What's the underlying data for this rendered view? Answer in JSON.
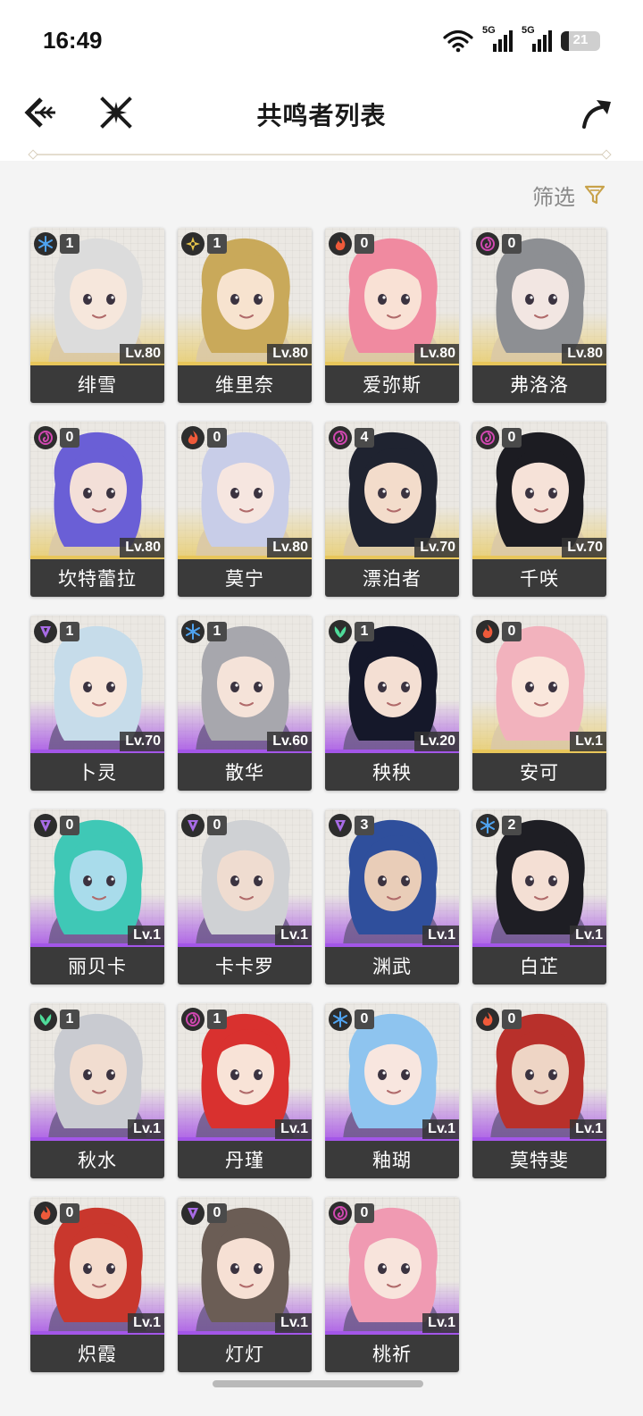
{
  "status_bar": {
    "time": "16:49",
    "network_1": "5G",
    "network_2": "5G",
    "battery_level": "21"
  },
  "header": {
    "title": "共鸣者列表",
    "back_icon": "back-arrow-icon",
    "home_icon": "game-logo-icon",
    "share_icon": "share-arrow-icon"
  },
  "filter": {
    "label": "筛选",
    "icon": "filter-funnel-icon",
    "color": "#c8a24a"
  },
  "element_colors": {
    "glacio": "#4fa3f0",
    "spectro": "#e6c44a",
    "fusion": "#ef5a3a",
    "havoc": "#d048b0",
    "electro": "#a86be6",
    "aero": "#4fdc9a"
  },
  "characters": [
    {
      "name": "绯雪",
      "chain": "1",
      "level": "Lv.80",
      "element": "glacio",
      "rarity": 5,
      "hair": "#dcdcdc",
      "skin": "#f6e7dc"
    },
    {
      "name": "维里奈",
      "chain": "1",
      "level": "Lv.80",
      "element": "spectro",
      "rarity": 5,
      "hair": "#c9a95a",
      "skin": "#f7e3cf"
    },
    {
      "name": "爱弥斯",
      "chain": "0",
      "level": "Lv.80",
      "element": "fusion",
      "rarity": 5,
      "hair": "#f08aa0",
      "skin": "#f9e1d5"
    },
    {
      "name": "弗洛洛",
      "chain": "0",
      "level": "Lv.80",
      "element": "havoc",
      "rarity": 5,
      "hair": "#8d8f93",
      "skin": "#f2e6e2"
    },
    {
      "name": "坎特蕾拉",
      "chain": "0",
      "level": "Lv.80",
      "element": "havoc",
      "rarity": 5,
      "hair": "#6a5fd6",
      "skin": "#f3dfd8"
    },
    {
      "name": "莫宁",
      "chain": "0",
      "level": "Lv.80",
      "element": "fusion",
      "rarity": 5,
      "hair": "#c8cde8",
      "skin": "#f6e6e0"
    },
    {
      "name": "漂泊者",
      "chain": "4",
      "level": "Lv.70",
      "element": "havoc",
      "rarity": 5,
      "hair": "#1f2330",
      "skin": "#f3dccb"
    },
    {
      "name": "千咲",
      "chain": "0",
      "level": "Lv.70",
      "element": "havoc",
      "rarity": 5,
      "hair": "#1c1c22",
      "skin": "#f6e2d8"
    },
    {
      "name": "卜灵",
      "chain": "1",
      "level": "Lv.70",
      "element": "electro",
      "rarity": 4,
      "hair": "#c6dcea",
      "skin": "#f8e6da"
    },
    {
      "name": "散华",
      "chain": "1",
      "level": "Lv.60",
      "element": "glacio",
      "rarity": 4,
      "hair": "#a7a7ad",
      "skin": "#f5e3d9"
    },
    {
      "name": "秧秧",
      "chain": "1",
      "level": "Lv.20",
      "element": "aero",
      "rarity": 4,
      "hair": "#15182a",
      "skin": "#f4dfd3"
    },
    {
      "name": "安可",
      "chain": "0",
      "level": "Lv.1",
      "element": "fusion",
      "rarity": 5,
      "hair": "#f2b2bd",
      "skin": "#fae7dc"
    },
    {
      "name": "丽贝卡",
      "chain": "0",
      "level": "Lv.1",
      "element": "electro",
      "rarity": 4,
      "hair": "#3fc8b6",
      "skin": "#a9dceb"
    },
    {
      "name": "卡卡罗",
      "chain": "0",
      "level": "Lv.1",
      "element": "electro",
      "rarity": 4,
      "hair": "#cfd1d4",
      "skin": "#efdcd0"
    },
    {
      "name": "渊武",
      "chain": "3",
      "level": "Lv.1",
      "element": "electro",
      "rarity": 4,
      "hair": "#2f4f9c",
      "skin": "#e9cdb8"
    },
    {
      "name": "白芷",
      "chain": "2",
      "level": "Lv.1",
      "element": "glacio",
      "rarity": 4,
      "hair": "#1e1e24",
      "skin": "#f4dfd4"
    },
    {
      "name": "秋水",
      "chain": "1",
      "level": "Lv.1",
      "element": "aero",
      "rarity": 4,
      "hair": "#c9cbd1",
      "skin": "#f1ddd0"
    },
    {
      "name": "丹瑾",
      "chain": "1",
      "level": "Lv.1",
      "element": "havoc",
      "rarity": 4,
      "hair": "#d9312f",
      "skin": "#f8e3d7"
    },
    {
      "name": "釉瑚",
      "chain": "0",
      "level": "Lv.1",
      "element": "glacio",
      "rarity": 4,
      "hair": "#8ec4ef",
      "skin": "#f8e6df"
    },
    {
      "name": "莫特斐",
      "chain": "0",
      "level": "Lv.1",
      "element": "fusion",
      "rarity": 4,
      "hair": "#b8302b",
      "skin": "#eed5c5"
    },
    {
      "name": "炽霞",
      "chain": "0",
      "level": "Lv.1",
      "element": "fusion",
      "rarity": 4,
      "hair": "#c9372d",
      "skin": "#f5dccd"
    },
    {
      "name": "灯灯",
      "chain": "0",
      "level": "Lv.1",
      "element": "electro",
      "rarity": 4,
      "hair": "#6b5d55",
      "skin": "#f6e0d4"
    },
    {
      "name": "桃祈",
      "chain": "0",
      "level": "Lv.1",
      "element": "havoc",
      "rarity": 4,
      "hair": "#f09ab2",
      "skin": "#f8e4dc"
    }
  ]
}
